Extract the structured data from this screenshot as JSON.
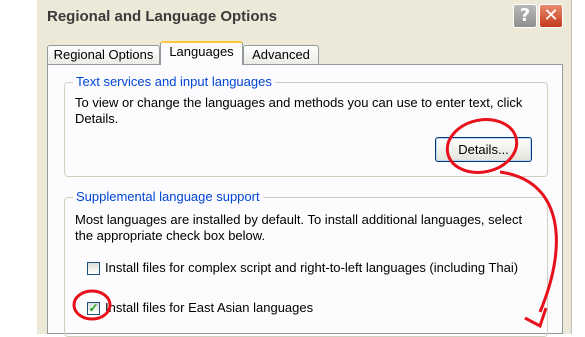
{
  "dialog": {
    "title": "Regional and Language Options",
    "help_button": "?",
    "close_button": "✕"
  },
  "tabs": [
    {
      "label": "Regional Options",
      "active": false
    },
    {
      "label": "Languages",
      "active": true
    },
    {
      "label": "Advanced",
      "active": false
    }
  ],
  "text_services": {
    "legend": "Text services and input languages",
    "description": "To view or change the languages and methods you can use to enter text, click Details.",
    "details_button": "Details..."
  },
  "supplemental": {
    "legend": "Supplemental language support",
    "description": "Most languages are installed by default. To install additional languages, select the appropriate check box below.",
    "complex_script": {
      "label": "Install files for complex script and right-to-left languages (including Thai)",
      "checked": false
    },
    "east_asian": {
      "label": "Install files for East Asian languages",
      "checked": true
    }
  },
  "annotation": {
    "color": "#e8101a"
  }
}
